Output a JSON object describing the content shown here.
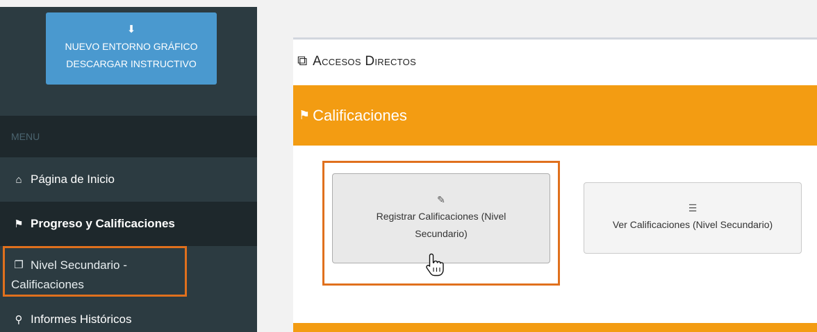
{
  "sidebar": {
    "download_button": {
      "icon": "download-icon",
      "line1": "NUEVO ENTORNO GRÁFICO",
      "line2": "DESCARGAR INSTRUCTIVO"
    },
    "menu_header": "MENU",
    "items": [
      {
        "icon": "home-icon",
        "label": "Página de Inicio"
      },
      {
        "icon": "flag-icon",
        "label": "Progreso y Calificaciones"
      },
      {
        "icon": "copy-icon",
        "label_line1": "Nivel Secundario -",
        "label_line2": "Calificaciones"
      },
      {
        "icon": "key-icon",
        "label": "Informes Históricos"
      }
    ]
  },
  "main": {
    "panel_title": "Accesos Directos",
    "panel_title_icon": "external-link-icon",
    "section_title": "Calificaciones",
    "section_icon": "flag-icon",
    "cards": [
      {
        "icon": "edit-icon",
        "line1": "Registrar Calificaciones (Nivel",
        "line2": "Secundario)"
      },
      {
        "icon": "list-icon",
        "label": "Ver Calificaciones (Nivel Secundario)"
      }
    ]
  },
  "colors": {
    "sidebar_bg": "#2c3b41",
    "sidebar_dark": "#1e282c",
    "download_button": "#4a99cf",
    "orange": "#f39c12",
    "highlight": "#e0701d"
  }
}
